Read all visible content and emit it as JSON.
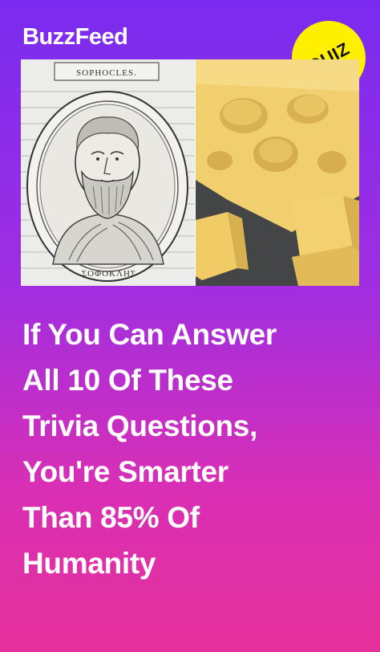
{
  "brand": {
    "name": "BuzzFeed"
  },
  "badge": {
    "label": "QUIZ",
    "color": "#ffef00"
  },
  "images": {
    "left": {
      "caption_top": "SOPHOCLES.",
      "caption_bottom": "ΣΟΦΟΚΛΗΣ",
      "subject": "engraved portrait of Sophocles"
    },
    "right": {
      "subject": "blocks of Swiss cheese"
    }
  },
  "headline": {
    "lines": [
      "If You Can Answer",
      "All 10 Of These",
      "Trivia Questions,",
      "You're Smarter",
      "Than 85% Of",
      "Humanity"
    ]
  },
  "colors": {
    "gradient_top": "#7a2bf0",
    "gradient_bottom": "#e6309a",
    "text": "#ffffff"
  }
}
